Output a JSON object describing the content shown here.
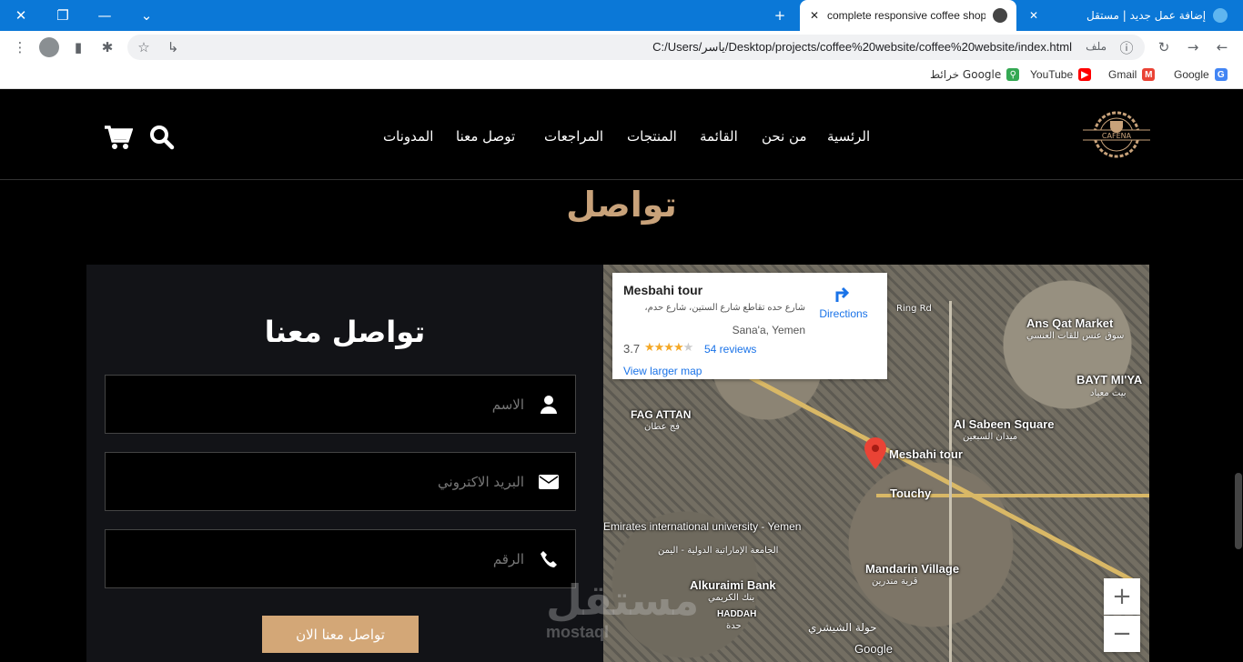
{
  "browser": {
    "tabs": [
      {
        "title": "complete responsive coffee shop",
        "active": true
      },
      {
        "title": "إضافة عمل جديد | مستقل",
        "active": false
      }
    ],
    "url": "C:/Users/ياسر/Desktop/projects/coffee%20website/coffee%20website/index.html",
    "file_label": "ملف",
    "bookmarks": [
      {
        "label": "Google",
        "icon": "google-icon",
        "color": "#4285f4"
      },
      {
        "label": "Gmail",
        "icon": "gmail-icon",
        "color": "#ea4335"
      },
      {
        "label": "YouTube",
        "icon": "youtube-icon",
        "color": "#ff0000"
      },
      {
        "label": "خرائط Google",
        "icon": "maps-icon",
        "color": "#34a853"
      }
    ]
  },
  "header": {
    "logo_text": "CAFENA",
    "nav": [
      "الرئسية",
      "من نحن",
      "القائمة",
      "المنتجات",
      "المراجعات",
      "توصل معنا",
      "المدونات"
    ]
  },
  "contact": {
    "section_title": "تواصل",
    "form_title": "تواصل معنا",
    "fields": {
      "name_placeholder": "الاسم",
      "email_placeholder": "البريد الاكتروني",
      "phone_placeholder": "الرقم"
    },
    "submit_label": "تواصل معنا الان"
  },
  "map": {
    "card": {
      "title": "Mesbahi tour",
      "address": "شارع حده تقاطع شارع الستين، شارع حدم،",
      "city": "Sana'a, Yemen",
      "rating": "3.7",
      "reviews": "54 reviews",
      "larger_map": "View larger map",
      "directions": "Directions"
    },
    "labels": {
      "ans_qat": "Ans Qat Market",
      "ans_qat_ar": "سوق عنس للقات العنسي",
      "bayt": "BAYT MI'YA",
      "bayt_ar": "بيت معياد",
      "fag_attan": "FAG ATTAN",
      "fag_attan_ar": "فج عطان",
      "sabeen": "Al Sabeen Square",
      "sabeen_ar": "ميدان السبعين",
      "mesbahi": "Mesbahi tour",
      "touchy": "Touchy",
      "emirates": "Emirates international university - Yemen",
      "emirates_ar": "الجامعة الإماراتية الدولية - اليمن",
      "mandarin": "Mandarin Village",
      "mandarin_ar": "قرية مندرين",
      "alkuraimi": "Alkuraimi Bank",
      "alkuraimi_ar": "بنك الكريمي",
      "haddah": "HADDAH",
      "haddah_ar": "حدة",
      "shishi": "حولة الشيشري",
      "ring": "Ring Rd",
      "google": "Google"
    },
    "zoom_in": "+",
    "zoom_out": "−"
  },
  "watermark": {
    "ar": "مستقل",
    "en": "mostaql"
  },
  "colors": {
    "accent": "#d3a777",
    "title": "#c8a27a",
    "chrome": "#0b78d7"
  }
}
